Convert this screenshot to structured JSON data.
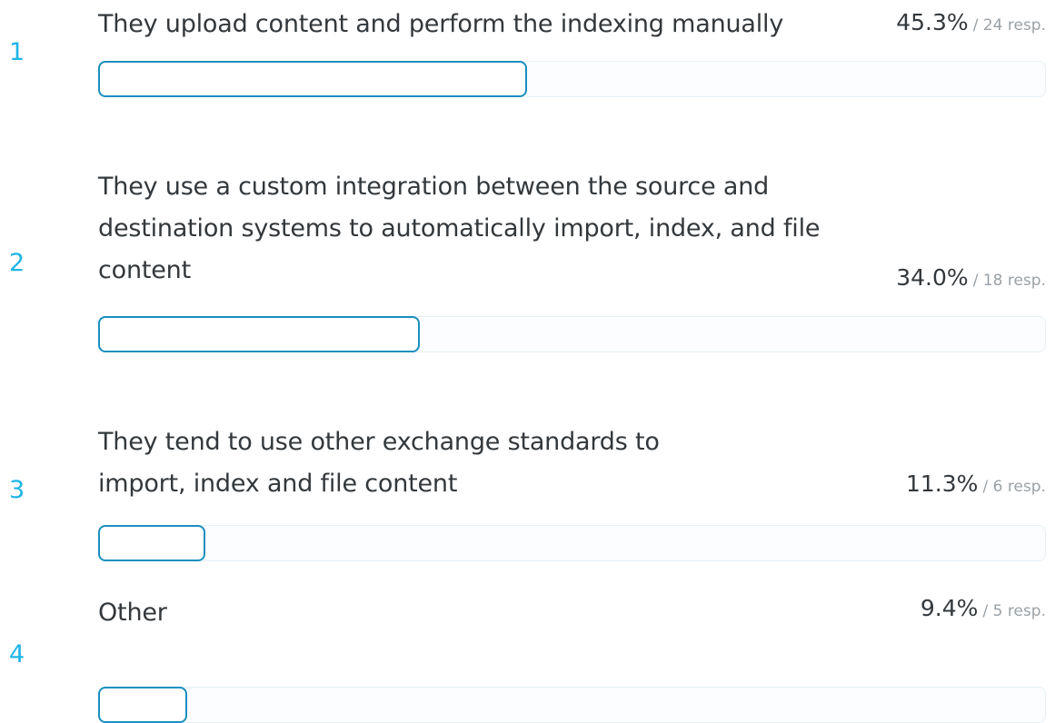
{
  "chart_data": {
    "type": "bar",
    "orientation": "horizontal",
    "items": [
      {
        "rank": "1",
        "label": "They upload content and perform the indexing manually",
        "percent": 45.3,
        "percent_label": "45.3%",
        "responses": 24,
        "responses_label": "/ 24 resp."
      },
      {
        "rank": "2",
        "label": "They use a custom integration between the source and destination systems to automatically import, index, and file content",
        "percent": 34.0,
        "percent_label": "34.0%",
        "responses": 18,
        "responses_label": "/ 18 resp."
      },
      {
        "rank": "3",
        "label": "They tend to use other exchange standards to import, index and file content",
        "percent": 11.3,
        "percent_label": "11.3%",
        "responses": 6,
        "responses_label": "/ 6 resp."
      },
      {
        "rank": "4",
        "label": "Other",
        "percent": 9.4,
        "percent_label": "9.4%",
        "responses": 5,
        "responses_label": "/ 5 resp."
      }
    ],
    "colors": {
      "rank": "#1fb5e6",
      "bar_border": "#1a8fbf",
      "track_border": "#e6f0f5"
    }
  }
}
